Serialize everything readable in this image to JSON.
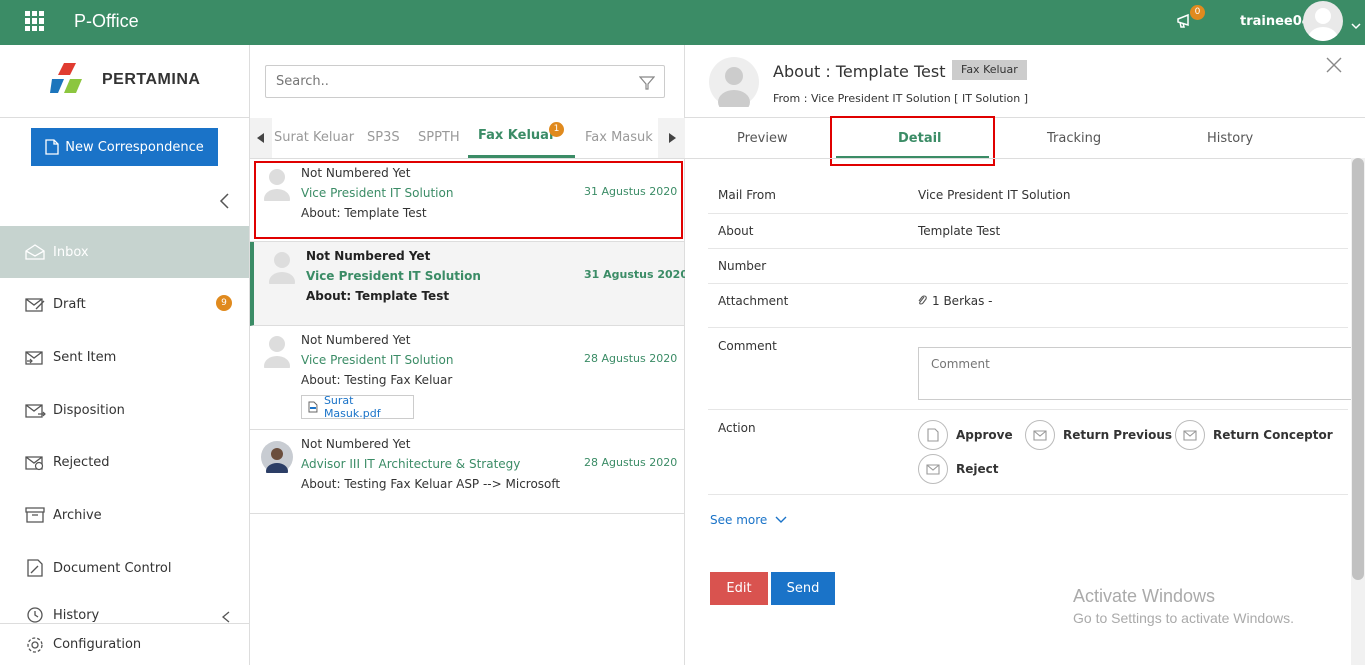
{
  "header": {
    "app_title": "P-Office",
    "notification_count": "0",
    "username": "trainee04"
  },
  "sidebar": {
    "logo_text": "PERTAMINA",
    "new_button": "New Correspondence",
    "items": [
      {
        "label": "Inbox"
      },
      {
        "label": "Draft",
        "badge": "9"
      },
      {
        "label": "Sent Item"
      },
      {
        "label": "Disposition"
      },
      {
        "label": "Rejected"
      },
      {
        "label": "Archive"
      },
      {
        "label": "Document Control"
      },
      {
        "label": "History"
      }
    ],
    "configuration": "Configuration"
  },
  "list": {
    "search_placeholder": "Search..",
    "tabs": [
      "Surat Keluar",
      "SP3S",
      "SPPTH",
      "Fax Keluar",
      "Fax Masuk"
    ],
    "active_tab_badge": "1",
    "mails": [
      {
        "number": "Not Numbered Yet",
        "from": "Vice President IT Solution",
        "date": "31 Agustus 2020",
        "about": "About: Template Test"
      },
      {
        "number": "Not Numbered Yet",
        "from": "Vice President IT Solution",
        "date": "31 Agustus 2020",
        "about": "About: Template Test"
      },
      {
        "number": "Not Numbered Yet",
        "from": "Vice President IT Solution",
        "date": "28 Agustus 2020",
        "about": "About: Testing Fax Keluar",
        "attachment": "Surat Masuk.pdf"
      },
      {
        "number": "Not Numbered Yet",
        "from": "Advisor III IT Architecture & Strategy",
        "date": "28 Agustus 2020",
        "about": "About: Testing Fax Keluar ASP --> Microsoft"
      }
    ]
  },
  "detail": {
    "title": "About : Template Test",
    "type_badge": "Fax Keluar",
    "from_line": "From : Vice President IT Solution [ IT Solution ]",
    "tabs": [
      "Preview",
      "Detail",
      "Tracking",
      "History"
    ],
    "fields": {
      "mail_from_label": "Mail From",
      "mail_from_value": "Vice President IT Solution",
      "about_label": "About",
      "about_value": "Template Test",
      "number_label": "Number",
      "attachment_label": "Attachment",
      "attachment_value": "1 Berkas -",
      "comment_label": "Comment",
      "comment_placeholder": "Comment",
      "action_label": "Action"
    },
    "actions": [
      "Approve",
      "Return Previous",
      "Return Conceptor",
      "Reject"
    ],
    "see_more": "See more",
    "edit_button": "Edit",
    "send_button": "Send"
  },
  "watermark": {
    "line1": "Activate Windows",
    "line2": "Go to Settings to activate Windows."
  },
  "colors": {
    "primary_green": "#3b8c66",
    "blue_button": "#1a73c8",
    "red_button": "#d9534f",
    "badge_orange": "#e08a1e",
    "highlight_red": "#e00000"
  }
}
